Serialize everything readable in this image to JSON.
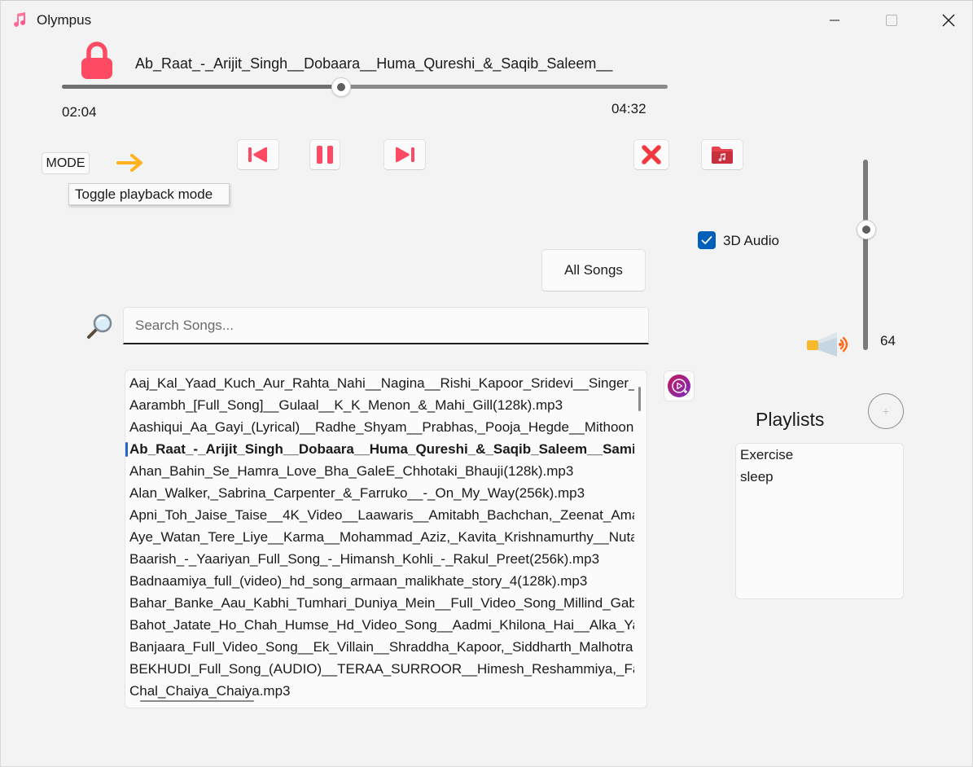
{
  "app": {
    "title": "Olympus",
    "accent": "#ff4760"
  },
  "player": {
    "now_playing": "Ab_Raat_-_Arijit_Singh__Dobaara__Huma_Qureshi_&_Saqib_Saleem__",
    "current_time": "02:04",
    "total_time": "04:32",
    "progress": 0.46,
    "locked": true
  },
  "controls": {
    "mode_label": "MODE",
    "mode_tooltip": "Toggle playback mode",
    "icons": [
      "lock-icon",
      "arrow-right-icon",
      "skip-previous-icon",
      "pause-icon",
      "skip-next-icon",
      "close-icon",
      "music-folder-icon"
    ]
  },
  "audio": {
    "three_d_label": "3D Audio",
    "three_d_checked": true,
    "volume": "64",
    "volume_level": 0.64
  },
  "library": {
    "all_songs_label": "All Songs",
    "search_placeholder": "Search Songs...",
    "selected_index": 3,
    "songs": [
      "Aaj_Kal_Yaad_Kuch_Aur_Rahta_Nahi__Nagina__Rishi_Kapoor_Sridevi__Singer_M",
      "Aarambh_[Full_Song]__Gulaal__K_K_Menon_&_Mahi_Gill(128k).mp3",
      "Aashiqui_Aa_Gayi_(Lyrical)__Radhe_Shyam__Prabhas,_Pooja_Hegde__Mithoon,_",
      "Ab_Raat_-_Arijit_Singh__Dobaara__Huma_Qureshi_&_Saqib_Saleem__Samir",
      "Ahan_Bahin_Se_Hamra_Love_Bha_GaleE_Chhotaki_Bhauji(128k).mp3",
      "Alan_Walker,_Sabrina_Carpenter_&_Farruko__-_On_My_Way(256k).mp3",
      "Apni_Toh_Jaise_Taise__4K_Video__Laawaris__Amitabh_Bachchan,_Zeenat_Aman",
      "Aye_Watan_Tere_Liye__Karma__Mohammad_Aziz,_Kavita_Krishnamurthy__Nuta",
      "Baarish_-_Yaariyan_Full_Song_-_Himansh_Kohli_-_Rakul_Preet(256k).mp3",
      "Badnaamiya_full_(video)_hd_song_armaan_malikhate_story_4(128k).mp3",
      "Bahar_Banke_Aau_Kabhi_Tumhari_Duniya_Mein__Full_Video_Song_Millind_Gab",
      "Bahot_Jatate_Ho_Chah_Humse_Hd_Video_Song__Aadmi_Khilona_Hai__Alka_Yag",
      "Banjaara_Full_Video_Song__Ek_Villain__Shraddha_Kapoor,_Siddharth_Malhotra",
      "BEKHUDI_Full_Song_(AUDIO)__TERAA_SURROOR__Himesh_Reshammiya,_Farah",
      "Chal_Chaiya_Chaiya.mp3"
    ]
  },
  "playlists": {
    "title": "Playlists",
    "add_label": "+",
    "items": [
      "Exercise",
      "sleep"
    ]
  }
}
